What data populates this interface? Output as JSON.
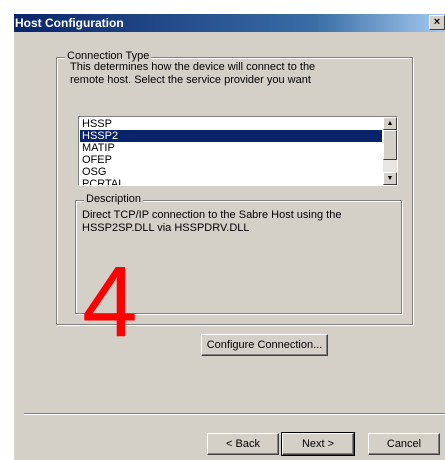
{
  "window": {
    "title": "Host Configuration",
    "close_label": "×"
  },
  "connection_type": {
    "legend": "Connection Type",
    "intro_line1": "This determines how the device will connect to the",
    "intro_line2": "remote host.  Select the service provider you want",
    "options": [
      "HSSP",
      "HSSP2",
      "MATIP",
      "OFEP",
      "OSG",
      "PCRTAL"
    ],
    "selected": "HSSP2"
  },
  "description": {
    "legend": "Description",
    "line1": "Direct TCP/IP connection to the Sabre Host using the",
    "line2": "HSSP2SP.DLL via HSSPDRV.DLL"
  },
  "buttons": {
    "configure": "Configure Connection...",
    "back": "< Back",
    "next": "Next >",
    "cancel": "Cancel"
  },
  "overlay": {
    "number": "4",
    "color": "#ff0000"
  },
  "colors": {
    "titlebar": "#0a246a",
    "selection": "#0a246a",
    "face": "#d4d0c8"
  }
}
